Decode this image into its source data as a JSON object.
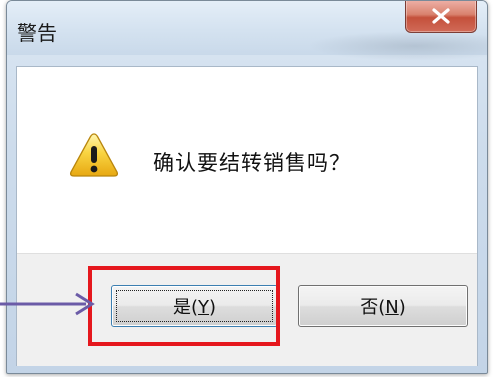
{
  "window": {
    "title": "警告",
    "close_symbol": "x"
  },
  "dialog": {
    "icon": "warning-icon",
    "message": "确认要结转销售吗？"
  },
  "buttons": {
    "yes_label": "是(",
    "yes_hotkey": "Y",
    "yes_suffix": ")",
    "no_label": "否(",
    "no_hotkey": "N",
    "no_suffix": ")"
  },
  "annotation": {
    "highlight_color": "#e5171d",
    "arrow_color": "#6b5ba7"
  }
}
